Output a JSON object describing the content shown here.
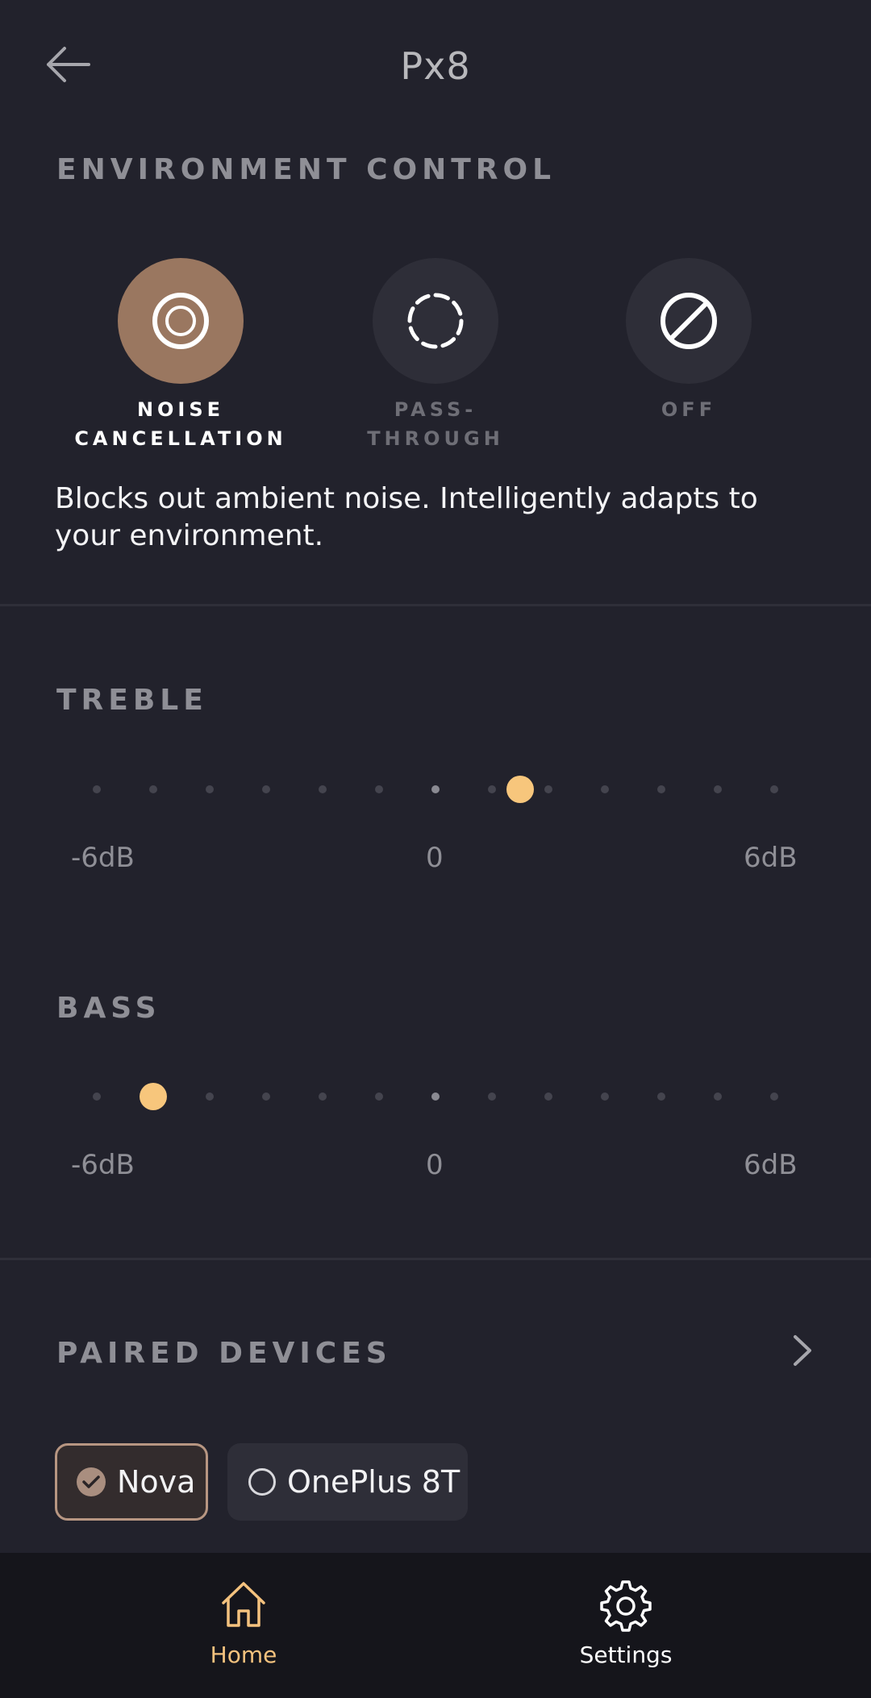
{
  "header": {
    "title": "Px8"
  },
  "environment": {
    "section_title": "ENVIRONMENT CONTROL",
    "modes": [
      {
        "label": "NOISE\nCANCELLATION",
        "icon": "noise-cancellation-icon",
        "active": true
      },
      {
        "label": "PASS-\nTHROUGH",
        "icon": "passthrough-icon",
        "active": false
      },
      {
        "label": "OFF",
        "icon": "off-icon",
        "active": false
      }
    ],
    "description": "Blocks out ambient noise. Intelligently adapts to your environment."
  },
  "treble": {
    "section_title": "TREBLE",
    "value_db": 1.5,
    "min_label": "-6dB",
    "mid_label": "0",
    "max_label": "6dB"
  },
  "bass": {
    "section_title": "BASS",
    "value_db": -5,
    "min_label": "-6dB",
    "mid_label": "0",
    "max_label": "6dB"
  },
  "paired_devices": {
    "section_title": "PAIRED DEVICES",
    "devices": [
      {
        "name": "Nova",
        "selected": true
      },
      {
        "name": "OnePlus 8T",
        "selected": false
      }
    ]
  },
  "nav": {
    "home_label": "Home",
    "settings_label": "Settings",
    "active": "home"
  },
  "colors": {
    "background": "#22222c",
    "accent": "#f7c67c",
    "active_mode": "#9a7760",
    "nav_active": "#f4c27e"
  }
}
